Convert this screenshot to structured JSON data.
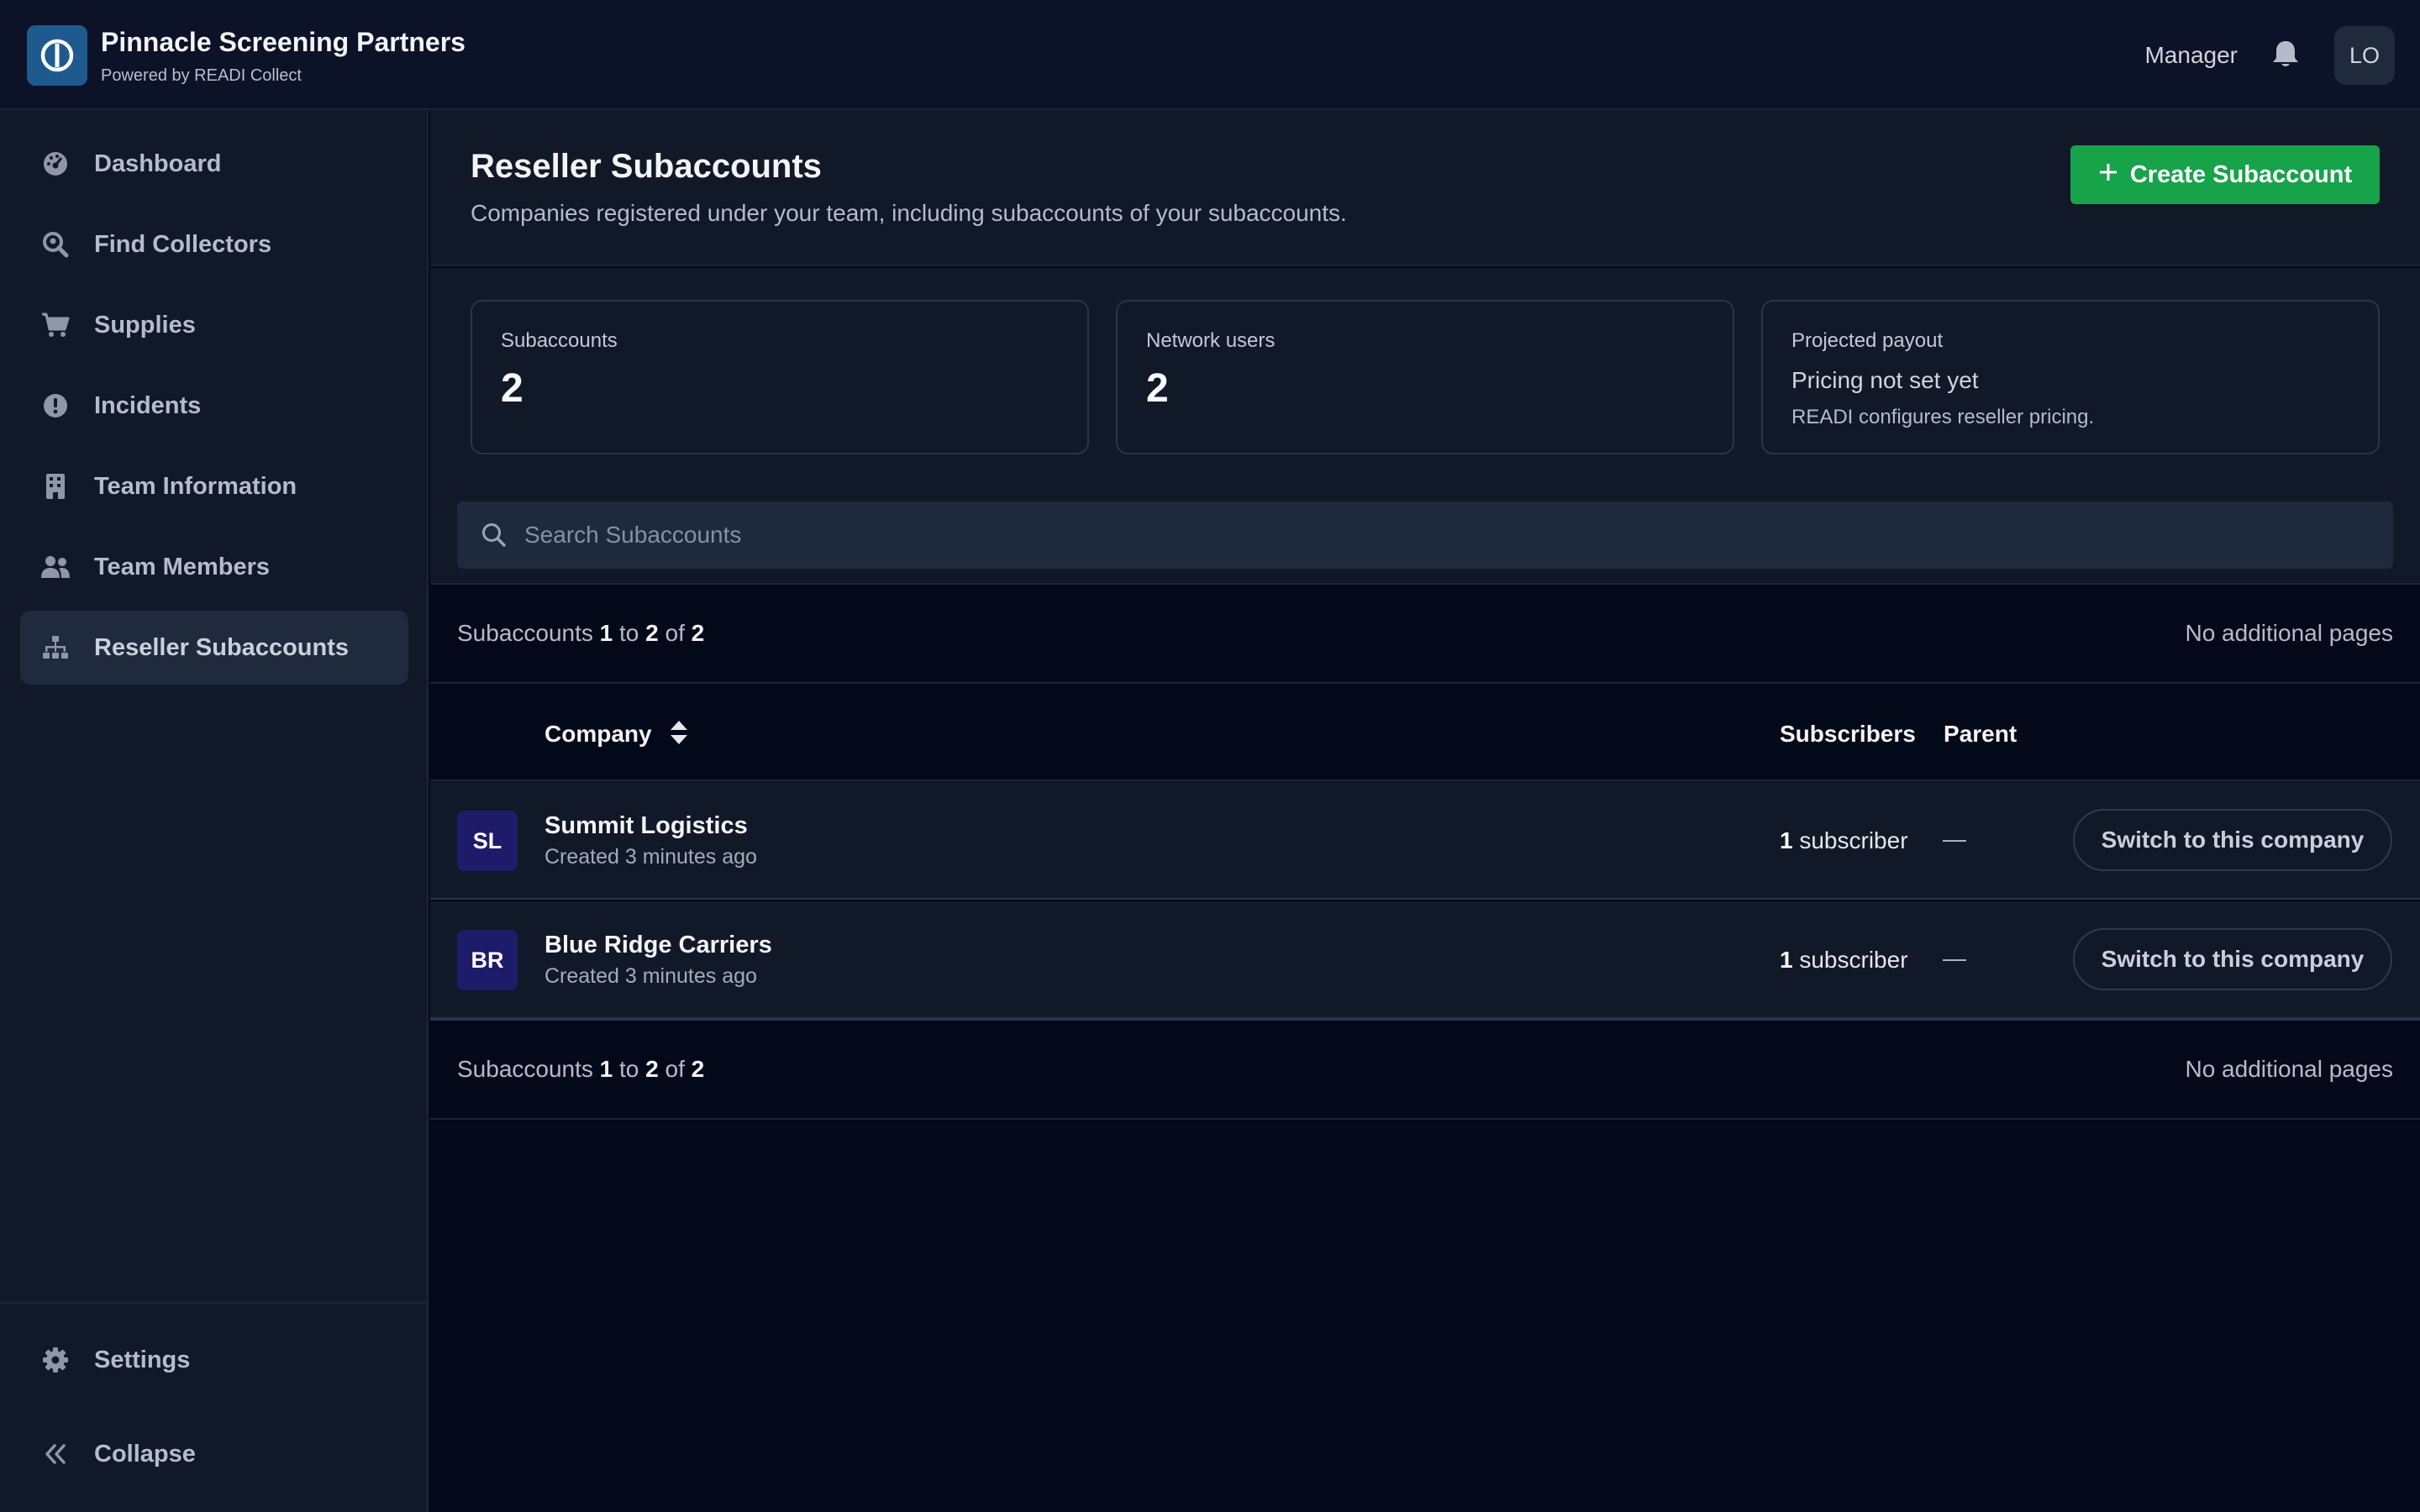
{
  "header": {
    "app_name": "Pinnacle Screening Partners",
    "powered_by": "Powered by READI Collect",
    "role": "Manager",
    "avatar_initials": "LO"
  },
  "sidebar": {
    "items": [
      {
        "label": "Dashboard",
        "icon": "gauge-icon"
      },
      {
        "label": "Find Collectors",
        "icon": "search-location-icon"
      },
      {
        "label": "Supplies",
        "icon": "cart-icon"
      },
      {
        "label": "Incidents",
        "icon": "alert-circle-icon"
      },
      {
        "label": "Team Information",
        "icon": "building-icon"
      },
      {
        "label": "Team Members",
        "icon": "users-icon"
      },
      {
        "label": "Reseller Subaccounts",
        "icon": "sitemap-icon",
        "active": true
      }
    ],
    "bottom": [
      {
        "label": "Settings",
        "icon": "gear-icon"
      },
      {
        "label": "Collapse",
        "icon": "double-chevron-left-icon"
      }
    ]
  },
  "page": {
    "title": "Reseller Subaccounts",
    "description": "Companies registered under your team, including subaccounts of your subaccounts.",
    "create_label": "Create Subaccount"
  },
  "stats": {
    "subaccounts_label": "Subaccounts",
    "subaccounts_value": "2",
    "network_label": "Network users",
    "network_value": "2",
    "payout_label": "Projected payout",
    "payout_value": "Pricing not set yet",
    "payout_note": "READI configures reseller pricing."
  },
  "search": {
    "placeholder": "Search Subaccounts"
  },
  "pagination": {
    "prefix": "Subaccounts",
    "from": "1",
    "to_word": "to",
    "to": "2",
    "of_word": "of",
    "total": "2",
    "pages_text": "No additional pages"
  },
  "table": {
    "columns": {
      "company": "Company",
      "subscribers": "Subscribers",
      "parent": "Parent"
    },
    "rows": [
      {
        "initials": "SL",
        "name": "Summit Logistics",
        "created": "Created 3 minutes ago",
        "subscriber_count": "1",
        "subscriber_word": "subscriber",
        "parent": "—",
        "action": "Switch to this company"
      },
      {
        "initials": "BR",
        "name": "Blue Ridge Carriers",
        "created": "Created 3 minutes ago",
        "subscriber_count": "1",
        "subscriber_word": "subscriber",
        "parent": "—",
        "action": "Switch to this company"
      }
    ]
  },
  "colors": {
    "accent_green": "#16a34a",
    "avatar_indigo": "#1e1b6b",
    "logo_blue": "#1e5a8e"
  }
}
